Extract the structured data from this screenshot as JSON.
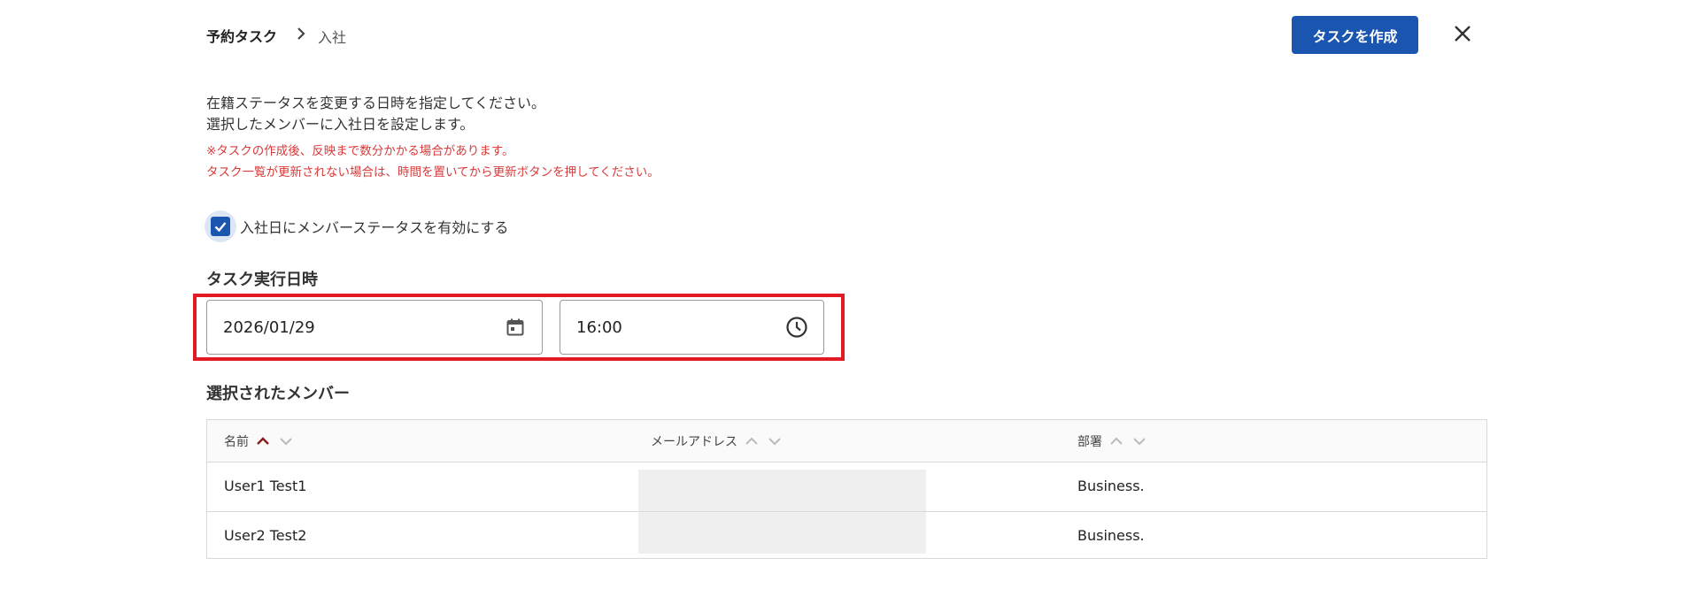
{
  "header": {
    "breadcrumb_root": "予約タスク",
    "breadcrumb_current": "入社",
    "create_button": "タスクを作成"
  },
  "description": {
    "line1": "在籍ステータスを変更する日時を指定してください。",
    "line2": "選択したメンバーに入社日を設定します。",
    "warning1": "※タスクの作成後、反映まで数分かかる場合があります。",
    "warning2": "タスク一覧が更新されない場合は、時間を置いてから更新ボタンを押してください。"
  },
  "checkbox": {
    "label": "入社日にメンバーステータスを有効にする",
    "checked": true
  },
  "schedule": {
    "title": "タスク実行日時",
    "date_value": "2026/01/29",
    "time_value": "16:00"
  },
  "members": {
    "title": "選択されたメンバー",
    "columns": [
      "名前",
      "メールアドレス",
      "部署"
    ],
    "rows": [
      {
        "name": "User1 Test1",
        "dept": "Business."
      },
      {
        "name": "User2 Test2",
        "dept": "Business."
      }
    ]
  },
  "colors": {
    "primary": "#1a56b0",
    "warning": "#d93a3a",
    "highlight": "#e01b24",
    "sort_active": "#8b1a1a"
  }
}
